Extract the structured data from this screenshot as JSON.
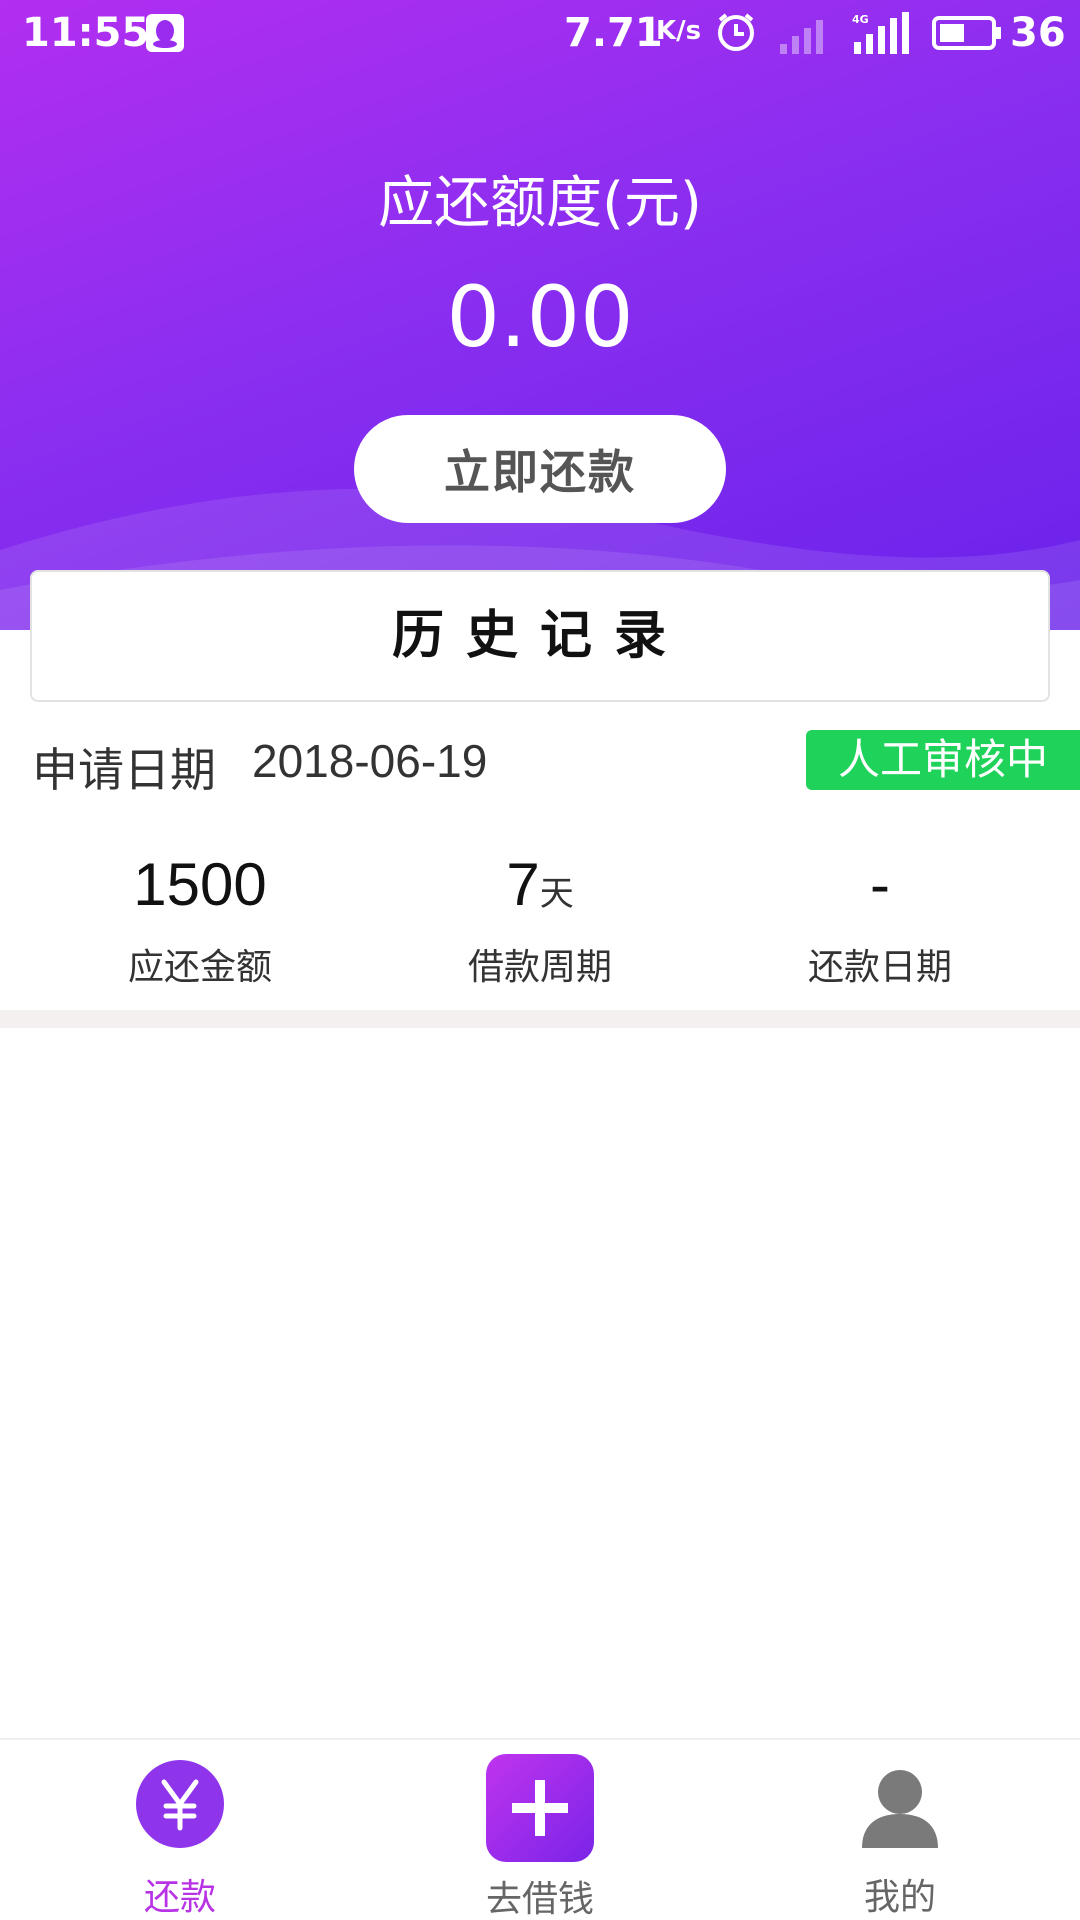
{
  "statusbar": {
    "time": "11:55",
    "speed": "7.71",
    "speed_unit": "K/s",
    "battery": "36",
    "icons": [
      "qq-icon",
      "alarm-icon",
      "signal-icon",
      "signal-4g-icon",
      "battery-icon"
    ]
  },
  "header": {
    "title": "应还额度(元)",
    "amount": "0.00",
    "repay_button": "立即还款"
  },
  "history": {
    "title": "历史记录"
  },
  "record": {
    "date_label": "申请日期",
    "date_value": "2018-06-19",
    "status": "人工审核中",
    "stats": [
      {
        "value": "1500",
        "unit": "",
        "label": "应还金额"
      },
      {
        "value": "7",
        "unit": "天",
        "label": "借款周期"
      },
      {
        "value": "-",
        "unit": "",
        "label": "还款日期"
      }
    ]
  },
  "bottom_nav": {
    "items": [
      {
        "label": "还款",
        "icon": "yen-icon",
        "active": true
      },
      {
        "label": "去借钱",
        "icon": "plus-icon",
        "active": false
      },
      {
        "label": "我的",
        "icon": "user-icon",
        "active": false
      }
    ]
  },
  "colors": {
    "header_gradient_start": "#b22ef0",
    "header_gradient_end": "#6a22ea",
    "status_badge": "#1fd35a",
    "nav_active": "#b833e6",
    "nav_inactive": "#666666"
  }
}
